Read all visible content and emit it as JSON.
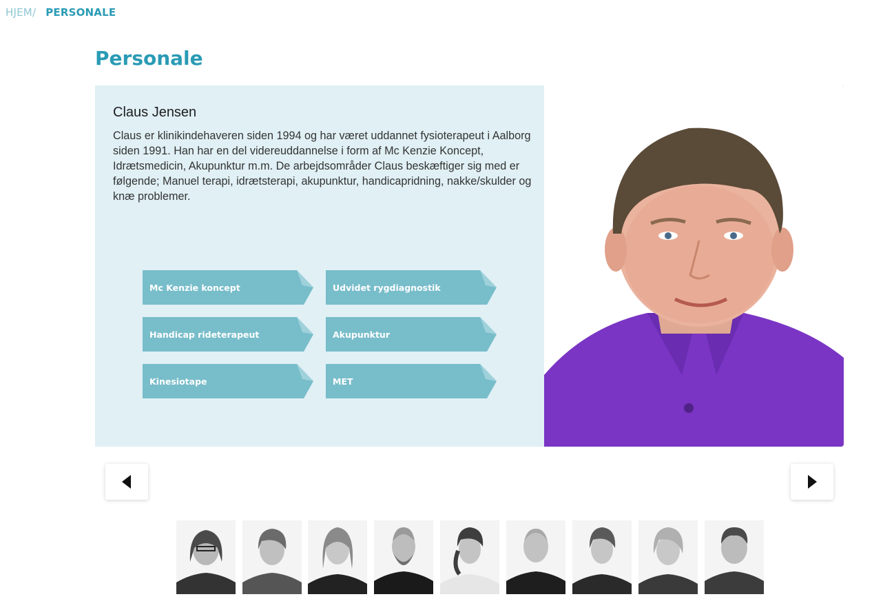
{
  "breadcrumb": {
    "home": "HJEM",
    "separator": "/",
    "current": "PERSONALE"
  },
  "page": {
    "title": "Personale"
  },
  "person": {
    "name": "Claus Jensen",
    "bio": "Claus er klinikindehaveren siden 1994 og har været uddannet fysioterapeut i Aalborg siden 1991. Han har en del videreuddannelse i form af Mc Kenzie Koncept, Idrætsmedicin, Akupunktur m.m. De arbejdsområder Claus beskæftiger sig med er følgende; Manuel terapi, idrætsterapi, akupunktur, handicapridning, nakke/skulder og knæ problemer.",
    "skills": [
      "Mc Kenzie koncept",
      "Udvidet rygdiagnostik",
      "Handicap rideterapeut",
      "Akupunktur",
      "Kinesiotape",
      "MET"
    ]
  },
  "nav": {
    "prev_icon": "caret-left-icon",
    "next_icon": "caret-right-icon"
  },
  "colors": {
    "accent": "#2a9bb5",
    "card_bg": "#e0f0f5",
    "tag_bg": "#78bdca",
    "shirt": "#7a35c4"
  }
}
